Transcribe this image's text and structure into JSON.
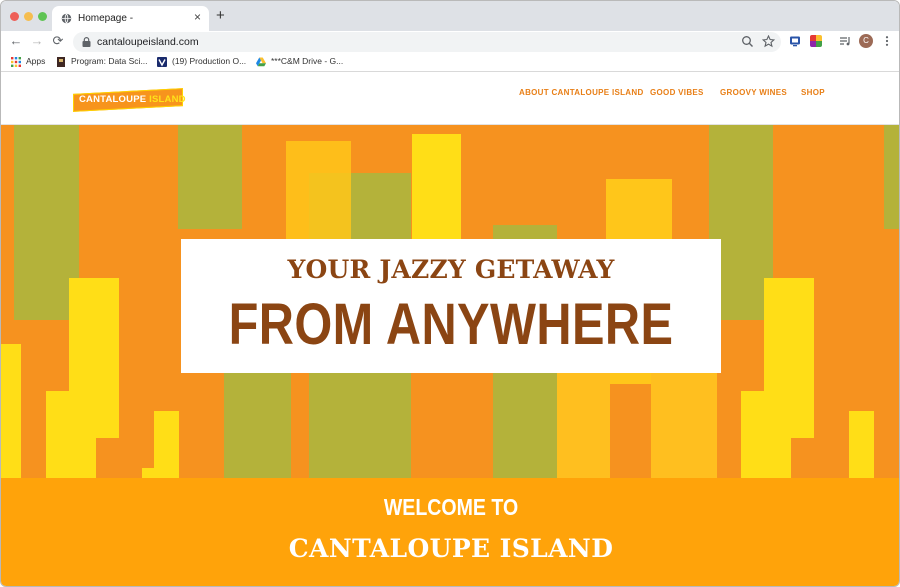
{
  "browser": {
    "tab_title": "Homepage -",
    "tab_close_glyph": "×",
    "new_tab_glyph": "+",
    "url": "cantaloupeisland.com",
    "profile_initial": "C",
    "nav": {
      "back_glyph": "←",
      "forward_glyph": "→",
      "reload_glyph": "⟳"
    },
    "bookmarks": [
      {
        "label": "Apps",
        "icon": "apps-grid-icon"
      },
      {
        "label": "Program: Data Sci...",
        "icon": "bookmark-icon"
      },
      {
        "label": "(19) Production O...",
        "icon": "bookmark-v-icon"
      },
      {
        "label": "***C&M Drive - G...",
        "icon": "drive-icon"
      }
    ]
  },
  "site": {
    "logo": {
      "word1": "CANTALOUPE",
      "word2": "ISLAND"
    },
    "nav": [
      {
        "label": "ABOUT CANTALOUPE ISLAND"
      },
      {
        "label": "GOOD VIBES"
      },
      {
        "label": "GROOVY WINES"
      },
      {
        "label": "SHOP"
      }
    ],
    "hero": {
      "line1": "YOUR JAZZY GETAWAY",
      "line2": "FROM ANYWHERE"
    },
    "welcome": {
      "line1": "WELCOME TO",
      "line2": "CANTALOUPE ISLAND"
    }
  },
  "colors": {
    "orange": "#f6921f",
    "brown": "#8b4513",
    "olive": "#b4b23a",
    "yellow": "#ffde17",
    "welcome_band": "#ffa30a",
    "nav_link": "#e87f17"
  }
}
